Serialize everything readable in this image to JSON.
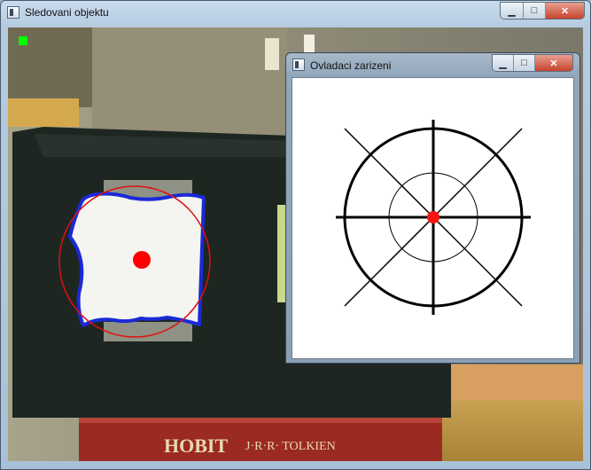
{
  "main_window": {
    "title": "Sledovani objektu",
    "controls": {
      "minimize": "▁",
      "maximize": "□",
      "close": "✕"
    }
  },
  "camera_scene": {
    "book_title": "HOBIT",
    "book_author": "J·R·R· TOLKIEN",
    "status_indicator_color": "#00ff00",
    "tracked_contour_color": "#0000cc",
    "enclosing_circle_color": "#dd1111",
    "centroid_color": "#ff0000"
  },
  "controller_window": {
    "title": "Ovladaci zarizeni",
    "controls": {
      "minimize": "▁",
      "maximize": "□",
      "close": "✕"
    },
    "marker_color": "#ff1111"
  }
}
